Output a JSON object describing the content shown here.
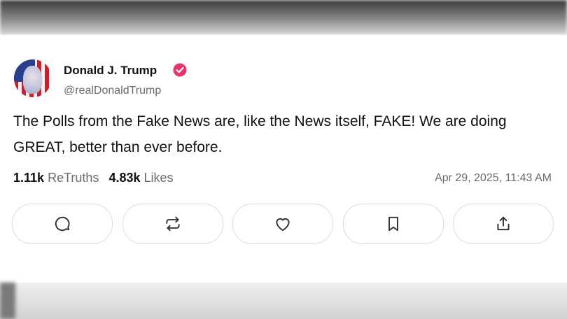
{
  "post": {
    "author_name": "Donald J. Trump",
    "handle": "@realDonaldTrump",
    "verified_color": "#e8356a",
    "text": "The Polls from the Fake News are, like the News itself, FAKE! We are doing GREAT, better than ever before.",
    "retruths_count": "1.11k",
    "retruths_label": "ReTruths",
    "likes_count": "4.83k",
    "likes_label": "Likes",
    "timestamp": "Apr 29, 2025, 11:43 AM"
  },
  "actions": [
    {
      "icon": "reply-icon"
    },
    {
      "icon": "retruth-icon"
    },
    {
      "icon": "heart-icon"
    },
    {
      "icon": "bookmark-icon"
    },
    {
      "icon": "share-icon"
    }
  ]
}
